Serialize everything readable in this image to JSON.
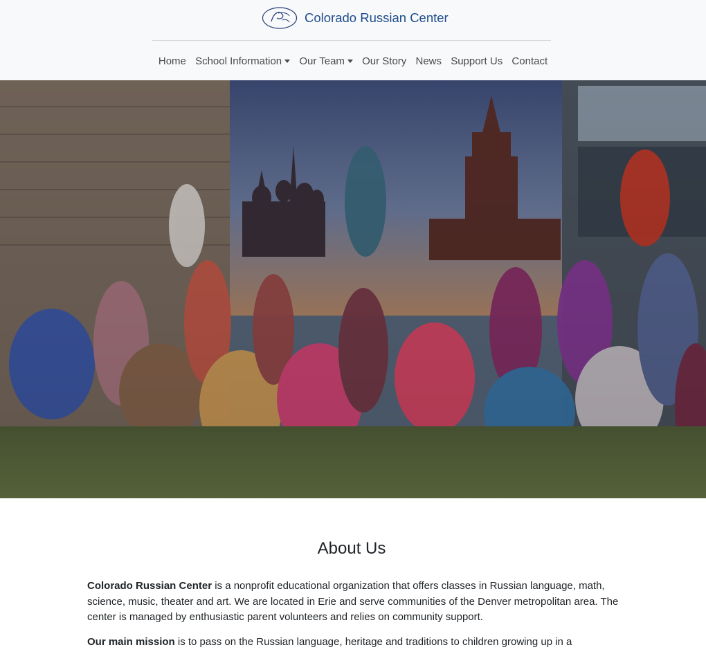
{
  "site": {
    "brand_name": "Colorado Russian Center"
  },
  "nav": {
    "items": [
      {
        "label": "Home",
        "dropdown": false
      },
      {
        "label": "School Information",
        "dropdown": true
      },
      {
        "label": "Our Team",
        "dropdown": true
      },
      {
        "label": "Our Story",
        "dropdown": false
      },
      {
        "label": "News",
        "dropdown": false
      },
      {
        "label": "Support Us",
        "dropdown": false
      },
      {
        "label": "Contact",
        "dropdown": false
      }
    ]
  },
  "hero": {
    "image": "group-photo-children-in-russian-costumes-in-front-of-moscow-backdrop"
  },
  "about": {
    "heading": "About Us",
    "para1_strong": "Colorado Russian Center",
    "para1_rest": " is a nonprofit educational organization that offers classes in Russian language, math, science, music, theater and art. We are located in Erie and serve communities of the Denver metropolitan area. The center is managed by enthusiastic parent volunteers and relies on community support.",
    "para2_strong": "Our main mission",
    "para2_rest": " is to pass on the Russian language, heritage and traditions to children growing up in a"
  },
  "colors": {
    "header_bg": "#f8f9fa",
    "brand": "#1f4e8c",
    "nav_text": "#4a4a4a",
    "body_text": "#212529"
  }
}
